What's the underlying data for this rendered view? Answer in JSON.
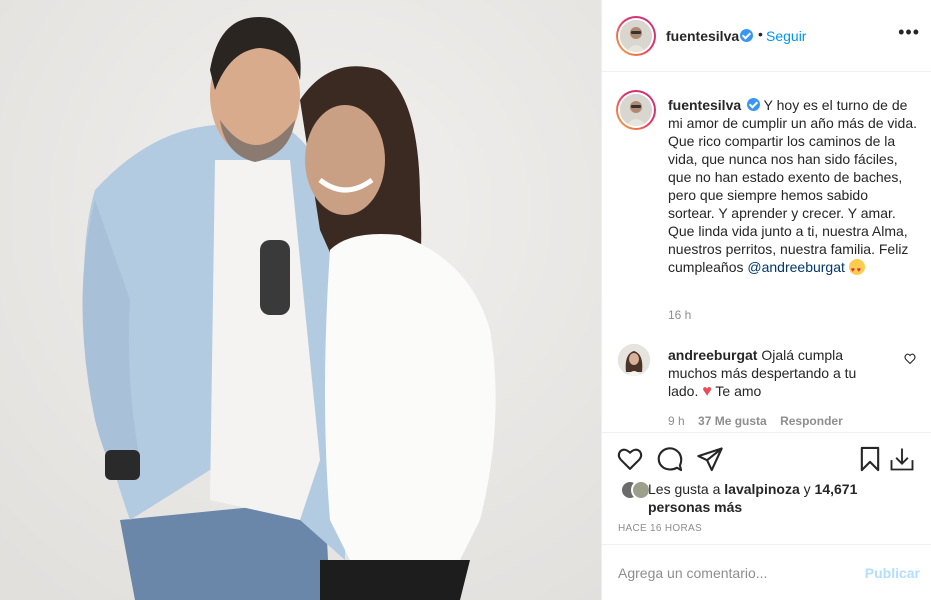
{
  "post": {
    "image_alt": "Pareja sonriendo sobre fondo claro"
  },
  "header": {
    "username": "fuentesilva",
    "dot": "•",
    "follow_label": "Seguir",
    "more_label": "•••"
  },
  "caption": {
    "username": "fuentesilva",
    "text": "Y hoy es el turno de de mi amor de cumplir un año más de vida. Que rico compartir los caminos de la vida, que nunca nos han sido fáciles, que no han estado exento de baches, pero que siempre hemos sabido sortear. Y aprender y crecer. Y amar. Que linda vida junto a ti, nuestra Alma, nuestros perritos, nuestra familia. Feliz cumpleaños",
    "mention": "@andreeburgat",
    "time": "16 h"
  },
  "reply": {
    "username": "andreeburgat",
    "text": "Ojalá cumpla muchos más despertando a tu lado.",
    "text_end": "Te amo",
    "time": "9 h",
    "likes": "37 Me gusta",
    "reply_label": "Responder"
  },
  "likes": {
    "prefix": "Les gusta a",
    "user": "lavalpinoza",
    "middle": "y",
    "count": "14,671 personas más"
  },
  "timestamp": "HACE 16 HORAS",
  "comment_box": {
    "placeholder": "Agrega un comentario...",
    "post_label": "Publicar"
  },
  "colors": {
    "link_blue": "#0095f6",
    "post_disabled": "#b2dffc",
    "heart_red": "#ed4956",
    "muted": "#8e8e8e",
    "text": "#262626"
  },
  "icons": [
    "verified-badge-icon",
    "heart-icon",
    "comment-icon",
    "share-icon",
    "bookmark-icon",
    "download-icon",
    "more-options-icon",
    "red-heart-icon",
    "smiling-face-with-hearts-icon"
  ]
}
